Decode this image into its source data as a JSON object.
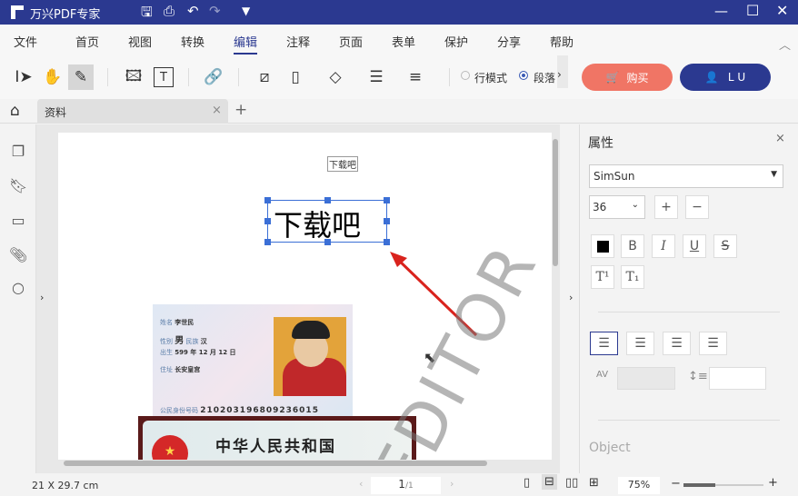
{
  "app": {
    "title": "万兴PDF专家"
  },
  "menu": [
    "文件",
    "首页",
    "视图",
    "转换",
    "编辑",
    "注释",
    "页面",
    "表单",
    "保护",
    "分享",
    "帮助"
  ],
  "toolbar": {
    "line_mode": "行模式",
    "paragraph_mode": "段落",
    "buy": "购买",
    "user": "L U"
  },
  "tabs": {
    "doc": "资料",
    "close": "×",
    "add": "+"
  },
  "page": {
    "small_label": "下载吧",
    "selected_text": "下载吧",
    "watermark": "EDITOR",
    "id_card": {
      "name_label": "姓名",
      "name": "李世民",
      "sex_label": "性别",
      "sex": "男",
      "nation_label": "民族",
      "nation": "汉",
      "birth_label": "出生",
      "birth": "599 年 12 月 12 日",
      "addr_label": "住址",
      "addr": "长安皇宫",
      "id_label": "公民身份号码",
      "id": "210203196809236015",
      "country": "中华人民共和国"
    }
  },
  "props": {
    "title": "属性",
    "close": "×",
    "font": "SimSun",
    "size": "36",
    "plus": "+",
    "minus": "−",
    "bold": "B",
    "italic": "I",
    "underline": "U",
    "strike": "S",
    "sup": "T¹",
    "sub": "T₁",
    "object": "Object",
    "text_color": "#000000"
  },
  "status": {
    "page_size": "21 X 29.7 cm",
    "page": "1",
    "page_total": "/1",
    "zoom": "75%",
    "zoom_minus": "−",
    "zoom_plus": "+"
  }
}
